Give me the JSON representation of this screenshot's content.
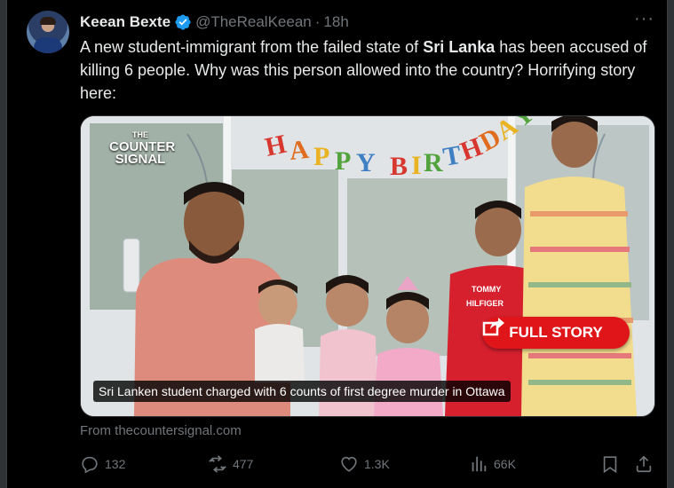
{
  "tweet": {
    "display_name": "Keean Bexte",
    "handle": "@TheRealKeean",
    "separator": "·",
    "time": "18h",
    "more_label": "···",
    "text_part1": "A new student-immigrant from the failed state of ",
    "text_bold": "Sri Lanka",
    "text_part2": " has been accused of killing 6 people. Why was this person allowed into the country? Horrifying story here:"
  },
  "media": {
    "banner_text": "HAPPY BIRTHDAY",
    "logo_the": "THE",
    "logo_line1": "COUNTER",
    "logo_line2": "SIGNAL",
    "shirt_text_1": "TOMMY",
    "shirt_text_2": "HILFIGER",
    "full_story_label": "FULL STORY",
    "caption": "Sri Lanken student charged with 6 counts of first degree murder in Ottawa"
  },
  "source_line": "From thecountersignal.com",
  "actions": {
    "replies": "132",
    "reposts": "477",
    "likes": "1.3K",
    "views": "66K"
  },
  "colors": {
    "background": "#000000",
    "text": "#e7e9ea",
    "muted": "#71767b",
    "verified": "#1d9bf0",
    "full_story_red": "#e0151a"
  }
}
